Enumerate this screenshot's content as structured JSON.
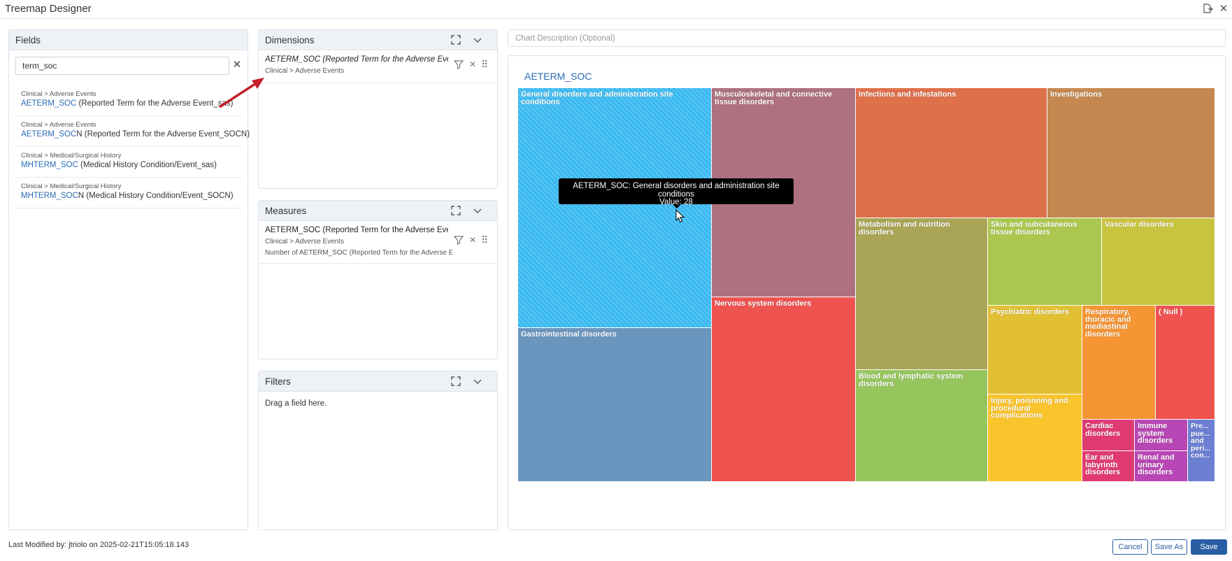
{
  "window": {
    "title": "Treemap Designer",
    "export_icon": "export-icon",
    "close_icon": "close-icon"
  },
  "fields_panel": {
    "title": "Fields",
    "search_value": "term_soc",
    "items": [
      {
        "path": "Clinical > Adverse Events",
        "highlight": "AETERM_SOC",
        "rest": " (Reported Term for the Adverse Event_sas)"
      },
      {
        "path": "Clinical > Adverse Events",
        "highlight": "AETERM_SOC",
        "rest": "N (Reported Term for the Adverse Event_SOCN)"
      },
      {
        "path": "Clinical > Medical/Surgical History",
        "highlight_prefix": "MH",
        "highlight": "TERM_SOC",
        "rest": " (Medical History Condition/Event_sas)"
      },
      {
        "path": "Clinical > Medical/Surgical History",
        "highlight_prefix": "MH",
        "highlight": "TERM_SOC",
        "rest": "N (Medical History Condition/Event_SOCN)"
      }
    ]
  },
  "dimensions_panel": {
    "title": "Dimensions",
    "card": {
      "title": "AETERM_SOC (Reported Term for the Adverse Event_sas)",
      "subtitle": "Clinical > Adverse Events"
    }
  },
  "measures_panel": {
    "title": "Measures",
    "card": {
      "title": "AETERM_SOC (Reported Term for the Adverse Event_sas)",
      "subtitle": "Clinical > Adverse Events",
      "aggregation": "Number of AETERM_SOC (Reported Term for the Adverse Event_sas)"
    }
  },
  "filters_panel": {
    "title": "Filters",
    "hint": "Drag a field here."
  },
  "chart": {
    "description_placeholder": "Chart Description (Optional)",
    "title": "AETERM_SOC",
    "tooltip": {
      "line1": "AETERM_SOC: General disorders and administration site conditions",
      "line2": "Value: 28"
    }
  },
  "chart_data": {
    "type": "treemap",
    "title": "AETERM_SOC",
    "tiles": [
      {
        "name": "General disorders and administration site conditions",
        "color": "#37b8f0",
        "value": 28
      },
      {
        "name": "Gastrointestinal disorders",
        "color": "#6a95bf"
      },
      {
        "name": "Musculoskeletal and connective tissue disorders",
        "color": "#ad717f"
      },
      {
        "name": "Nervous system disorders",
        "color": "#ef5350"
      },
      {
        "name": "Infections and infestations",
        "color": "#df704c"
      },
      {
        "name": "Investigations",
        "color": "#c48850"
      },
      {
        "name": "Metabolism and nutrition disorders",
        "color": "#aaa456"
      },
      {
        "name": "Blood and lymphatic system disorders",
        "color": "#96c55d"
      },
      {
        "name": "Skin and subcutaneous tissue disorders",
        "color": "#acc74f"
      },
      {
        "name": "Vascular disorders",
        "color": "#c9c43f"
      },
      {
        "name": "Psychiatric disorders",
        "color": "#e2c034"
      },
      {
        "name": "Injury, poisoning and procedural complications",
        "color": "#fac42d"
      },
      {
        "name": "Respiratory, thoracic and mediastinal disorders",
        "color": "#f59533"
      },
      {
        "name": "( Null )",
        "color": "#ef5350"
      },
      {
        "name": "Cardiac disorders",
        "color": "#e03a73"
      },
      {
        "name": "Ear and labyrinth disorders",
        "color": "#e03a73"
      },
      {
        "name": "Immune system disorders",
        "color": "#b846b4"
      },
      {
        "name": "Renal and urinary disorders",
        "color": "#b846b4"
      },
      {
        "name": "Pre... pue... and peri... con...",
        "color": "#6b7fd3"
      }
    ]
  },
  "footer": {
    "last_modified": "Last Modified by: jtriolo on 2025-02-21T15:05:18.143",
    "cancel_label": "Cancel",
    "save_as_label": "Save As",
    "save_label": "Save"
  }
}
